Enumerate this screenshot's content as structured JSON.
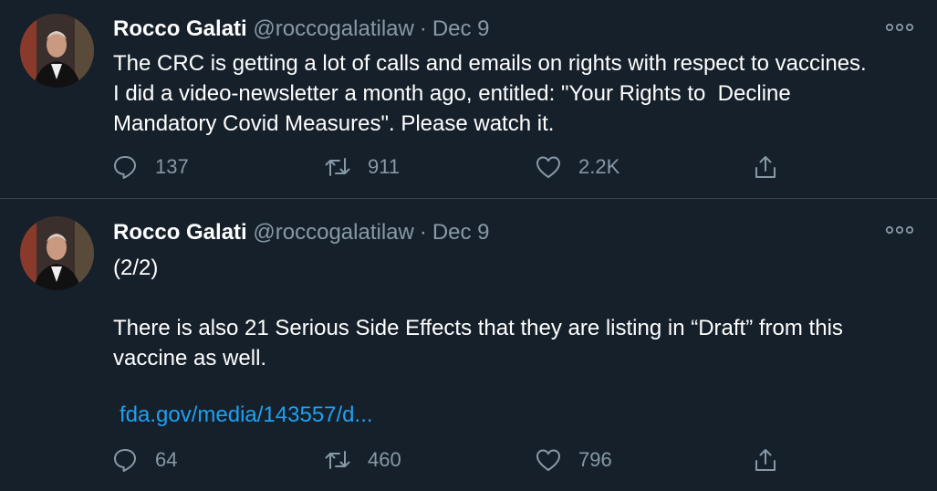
{
  "tweets": [
    {
      "author_name": "Rocco Galati",
      "handle": "@roccogalatilaw",
      "separator": "·",
      "date": "Dec 9",
      "text_lines": [
        "The CRC is getting a lot of calls and emails on rights with respect to vaccines.",
        "I did a video-newsletter a month ago, entitled: \"Your Rights to  Decline",
        "Mandatory Covid Measures\". Please watch it."
      ],
      "replies": "137",
      "retweets": "911",
      "likes": "2.2K"
    },
    {
      "author_name": "Rocco Galati",
      "handle": "@roccogalatilaw",
      "separator": "·",
      "date": "Dec 9",
      "text_lines": [
        "(2/2)",
        "There is also 21 Serious Side Effects that they are listing in “Draft” from this",
        "vaccine as well."
      ],
      "link": "fda.gov/media/143557/d...",
      "replies": "64",
      "retweets": "460",
      "likes": "796"
    }
  ],
  "icons": {
    "more": "more-horizontal-icon",
    "reply": "reply-icon",
    "retweet": "retweet-icon",
    "like": "heart-icon",
    "share": "share-icon"
  },
  "colors": {
    "background": "#15202b",
    "divider": "#38444d",
    "text": "#ffffff",
    "secondary": "#8899a6",
    "link": "#1da1f2"
  }
}
